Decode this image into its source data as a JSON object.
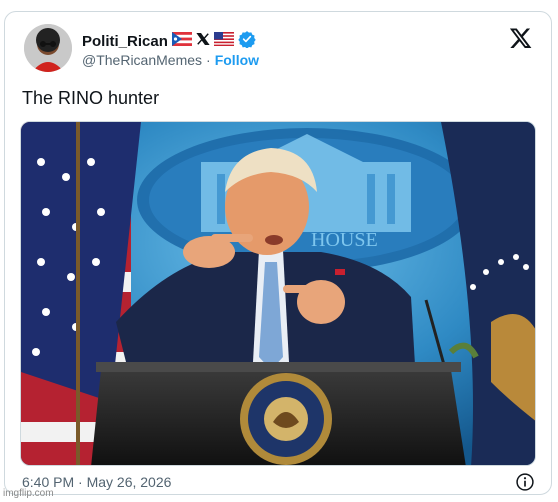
{
  "post": {
    "display_name": "Politi_Rican",
    "handle": "@TheRicanMemes",
    "separator": "·",
    "follow_label": "Follow",
    "text": "The RINO hunter",
    "timestamp": "6:40 PM · May 26, 2026",
    "header_badges": [
      "puerto-rico-flag-emoji",
      "x-emoji",
      "us-flag-emoji",
      "verified-badge-icon"
    ]
  },
  "media": {
    "podium_seal_text": "SEAL OF THE PRESIDENT OF THE UNITED STATES",
    "backdrop_text": "HOUSE"
  },
  "watermark": "imgflip.com",
  "colors": {
    "accent": "#1d9bf0",
    "text_primary": "#0f1419",
    "text_secondary": "#536471",
    "border": "#cfd9de"
  }
}
